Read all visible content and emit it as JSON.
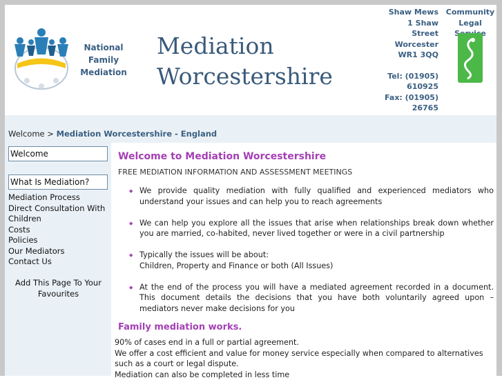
{
  "header": {
    "nfm_lines": [
      "National",
      "Family",
      "Mediation"
    ],
    "site_title_lines": [
      "Mediation",
      "Worcestershire"
    ],
    "address_lines": [
      "Shaw Mews",
      "1 Shaw Street",
      "Worcester",
      "WR1 3QQ"
    ],
    "contact_lines": [
      "Tel: (01905)",
      "610925",
      "Fax: (01905)",
      "26765"
    ],
    "cls_lines": [
      "Community",
      "Legal Service"
    ]
  },
  "breadcrumb": {
    "root": "Welcome",
    "separator": ">",
    "current": "Mediation Worcestershire - England"
  },
  "sidebar": {
    "boxed_items": [
      "Welcome",
      "What Is Mediation?"
    ],
    "links": [
      "Mediation Process",
      "Direct Consultation With",
      "Children",
      "Costs",
      "Policies",
      "Our Mediators",
      "Contact Us"
    ],
    "favourites": [
      "Add This Page To Your",
      "Favourites"
    ]
  },
  "main": {
    "title": "Welcome to Mediation Worcestershire",
    "intro": "FREE MEDIATION INFORMATION AND ASSESSMENT MEETINGS",
    "bullets": [
      {
        "lines": [
          "We provide quality mediation with fully qualified and experienced mediators who understand your issues and can help you to reach agreements"
        ]
      },
      {
        "lines": [
          "We can help you explore all the issues that arise when relationships break down whether you are married, co-habited, never lived together or were in a civil partnership"
        ]
      },
      {
        "lines": [
          "Typically the issues will be about:",
          "Children, Property and Finance or both (All Issues)"
        ]
      },
      {
        "lines": [
          "At the end of the process you will have a mediated agreement recorded in a document. This document details the decisions that you have both voluntarily agreed upon – mediators never make decisions for you"
        ]
      }
    ],
    "works_title": "Family mediation works.",
    "works_lines": [
      "90% of cases end in a full or partial agreement.",
      "We offer a cost efficient and value for money service especially when compared to alternatives such as a court or legal dispute.",
      "Mediation can also be completed in less time"
    ]
  },
  "colors": {
    "accent_purple": "#a440b5",
    "brand_blue": "#3a5f82",
    "panel_bg": "#eaf1f6",
    "cls_green": "#4cb848"
  }
}
